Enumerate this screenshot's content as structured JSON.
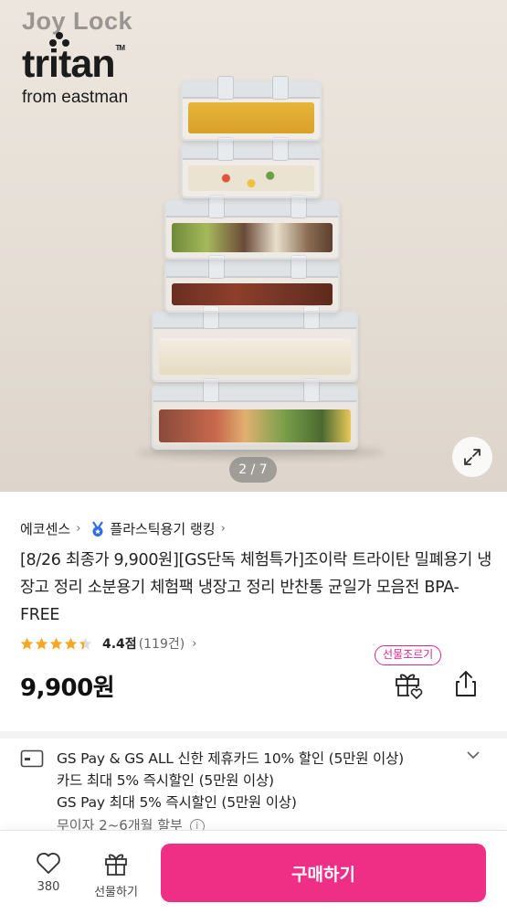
{
  "hero": {
    "brand_top": "Joy Lock",
    "brand_name": "tritan",
    "brand_tm": "TM",
    "brand_sub": "from eastman",
    "page_indicator": "2 / 7"
  },
  "breadcrumbs": {
    "brand": "에코센스",
    "ranking": "플라스틱용기 랭킹"
  },
  "product": {
    "title": "[8/26 최종가 9,900원][GS단독 체험특가]조이락 트라이탄 밀폐용기 냉장고 정리 소분용기 체험팩 냉장고 정리 반찬통 균일가 모음전 BPA-FREE",
    "rating_score": "4.4점",
    "rating_count": "(119건)",
    "rating_value": 4.4,
    "rating_max": 5,
    "price": "9,900원",
    "gift_badge": "선물조르기"
  },
  "benefits": {
    "lines": [
      "GS Pay & GS ALL 신한 제휴카드 10% 할인 (5만원 이상)",
      "카드 최대 5% 즉시할인 (5만원 이상)",
      "GS Pay 최대 5% 즉시할인 (5만원 이상)"
    ],
    "installment": "무이자 2~6개월 할부"
  },
  "bottom_bar": {
    "like_count": "380",
    "gift_label": "선물하기",
    "buy_label": "구매하기"
  },
  "colors": {
    "accent": "#ef2f86",
    "badge": "#e0258b",
    "star": "#f5a623",
    "hero_bg": "#e6dfd6"
  },
  "icons": [
    "expand-icon",
    "chevron-right-icon",
    "medal-icon",
    "star-icon",
    "gift-icon",
    "share-icon",
    "credit-card-icon",
    "chevron-down-icon",
    "info-icon",
    "heart-icon"
  ]
}
